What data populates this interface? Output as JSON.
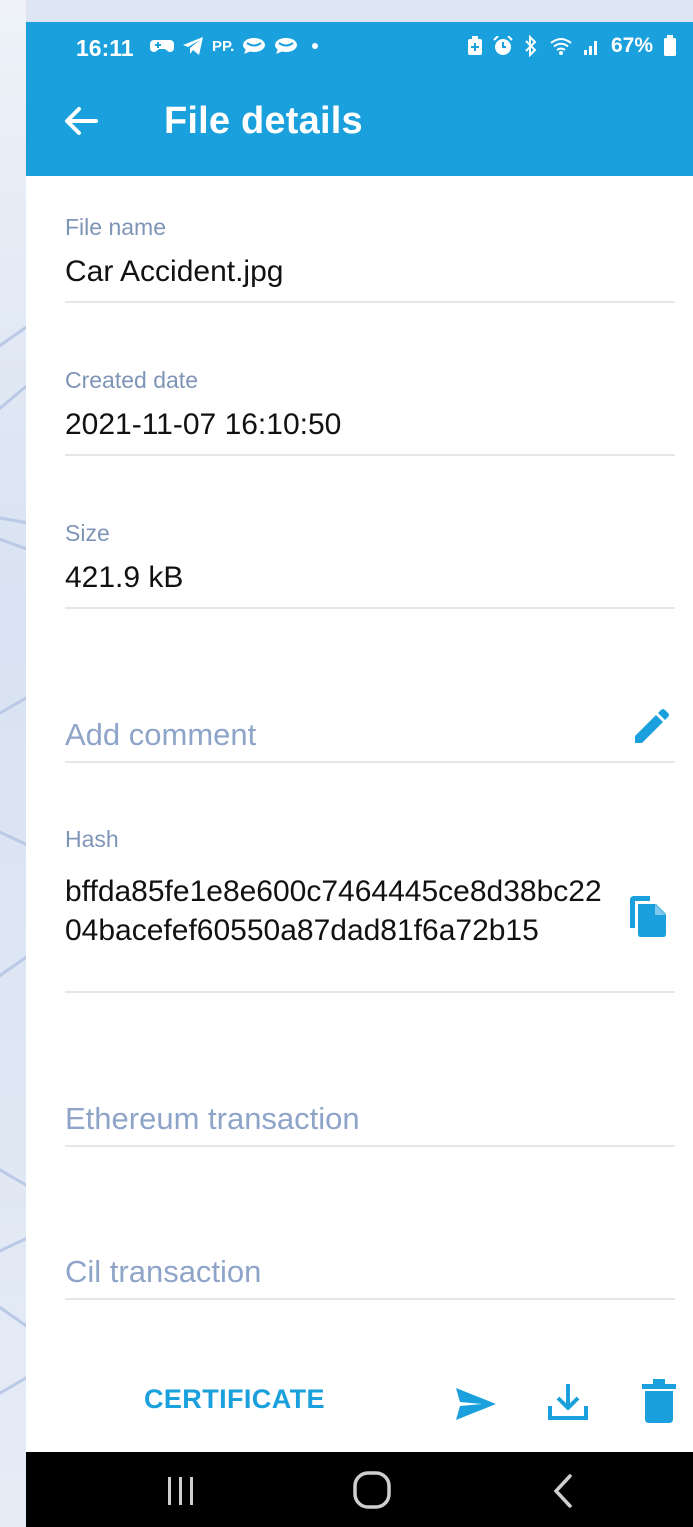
{
  "colors": {
    "accent": "#1aa0dc",
    "label": "#7f95b8",
    "placeholder": "#8ea4c8"
  },
  "status_bar": {
    "time": "16:11",
    "left_icons": [
      "gamepad-icon",
      "telegram-icon",
      "pp-icon",
      "chat-bubble-icon",
      "chat-bubble-icon",
      "dot-icon"
    ],
    "pp_text": "PP.",
    "battery": "67%",
    "right_icons": [
      "battery-saver-icon",
      "alarm-icon",
      "bluetooth-icon",
      "wifi-icon",
      "signal-icon",
      "battery-icon"
    ]
  },
  "app_bar": {
    "title": "File details",
    "back_icon": "arrow-left-icon"
  },
  "fields": {
    "file_name": {
      "label": "File name",
      "value": "Car Accident.jpg"
    },
    "created_date": {
      "label": "Created date",
      "value": "2021-11-07 16:10:50"
    },
    "size": {
      "label": "Size",
      "value": "421.9 kB"
    },
    "comment": {
      "placeholder": "Add comment",
      "icon": "pencil-icon"
    },
    "hash": {
      "label": "Hash",
      "value": "bffda85fe1e8e600c7464445ce8d38bc2204bacefef60550a87dad81f6a72b15",
      "icon": "copy-icon"
    },
    "ethereum": {
      "placeholder": "Ethereum transaction"
    },
    "cil": {
      "placeholder": "Cil transaction"
    }
  },
  "actions": {
    "certificate_label": "CERTIFICATE",
    "icons": [
      "send-icon",
      "download-icon",
      "trash-icon"
    ]
  },
  "nav_bar": {
    "icons": [
      "recents-icon",
      "home-icon",
      "back-chevron-icon"
    ]
  }
}
